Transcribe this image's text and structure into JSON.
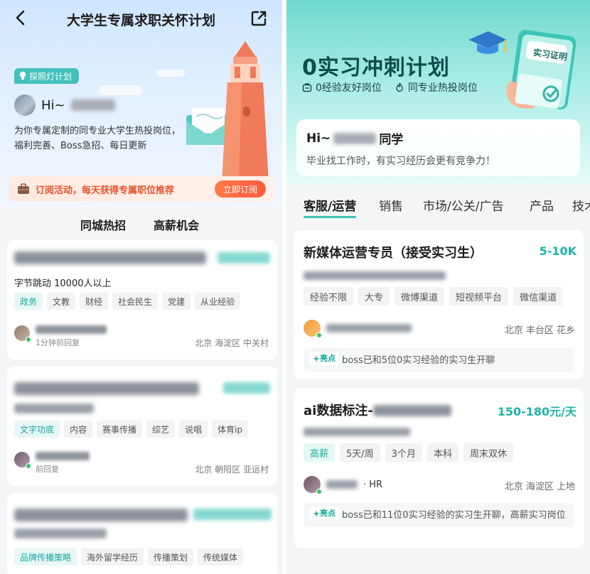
{
  "left": {
    "nav_title": "大学生专属求职关怀计划",
    "plan_badge": "探照灯计划",
    "greeting": "Hi~",
    "description": "为你专属定制的同专业大学生热投岗位，福利完善、Boss急招、每日更新",
    "subscribe_text": "订阅活动，每天获得专属职位推荐",
    "subscribe_button": "立即订阅",
    "tabs": [
      "同城热招",
      "高薪机会"
    ],
    "cards": [
      {
        "company": "字节跳动 10000人以上",
        "tags": [
          "政务",
          "文教",
          "财经",
          "社会民生",
          "党建",
          "从业经验"
        ],
        "recruiter_status": "1分钟前回复",
        "location": "北京 海淀区 中关村"
      },
      {
        "company": "",
        "tags": [
          "文字功底",
          "内容",
          "赛事传播",
          "综艺",
          "说唱",
          "体育ip"
        ],
        "recruiter_status": "前回复",
        "location": "北京 朝阳区 亚运村"
      },
      {
        "company": "",
        "tags": [
          "品牌传播策略",
          "海外留学经历",
          "传播策划",
          "传统媒体"
        ],
        "recruiter_status": "",
        "location": ""
      }
    ]
  },
  "right": {
    "hero_title": "0实习冲刺计划",
    "hero_sub": [
      "0经验友好岗位",
      "同专业热投岗位"
    ],
    "cert_label": "实习证明",
    "hi_title_prefix": "Hi~",
    "hi_title_suffix": "同学",
    "hi_desc": "毕业找工作时，有实习经历会更有竞争力！",
    "tabs": [
      "客服/运营",
      "销售",
      "市场/公关/广告",
      "产品",
      "技术"
    ],
    "highlight_badge": "亮点",
    "cards": [
      {
        "title": "新媒体运营专员（接受实习生）",
        "salary": "5-10K",
        "tags": [
          "经验不限",
          "大专",
          "微博渠道",
          "短视频平台",
          "微信渠道"
        ],
        "recruiter_hr": "",
        "location": "北京 丰台区 花乡",
        "highlight": "boss已和5位0实习经验的实习生开聊"
      },
      {
        "title": "ai数据标注-",
        "salary": "150-180元/天",
        "tags": [
          "高薪",
          "5天/周",
          "3个月",
          "本科",
          "周末双休"
        ],
        "recruiter_hr": "· HR",
        "location": "北京 海淀区 上地",
        "highlight": "boss已和11位0实习经验的实习生开聊，高薪实习岗位"
      }
    ]
  },
  "colors": {
    "accent_teal": "#3fc1b9",
    "salary_teal": "#1fb3a8",
    "subscribe_orange": "#ff5b3b",
    "tower_coral": "#f07a5a"
  }
}
